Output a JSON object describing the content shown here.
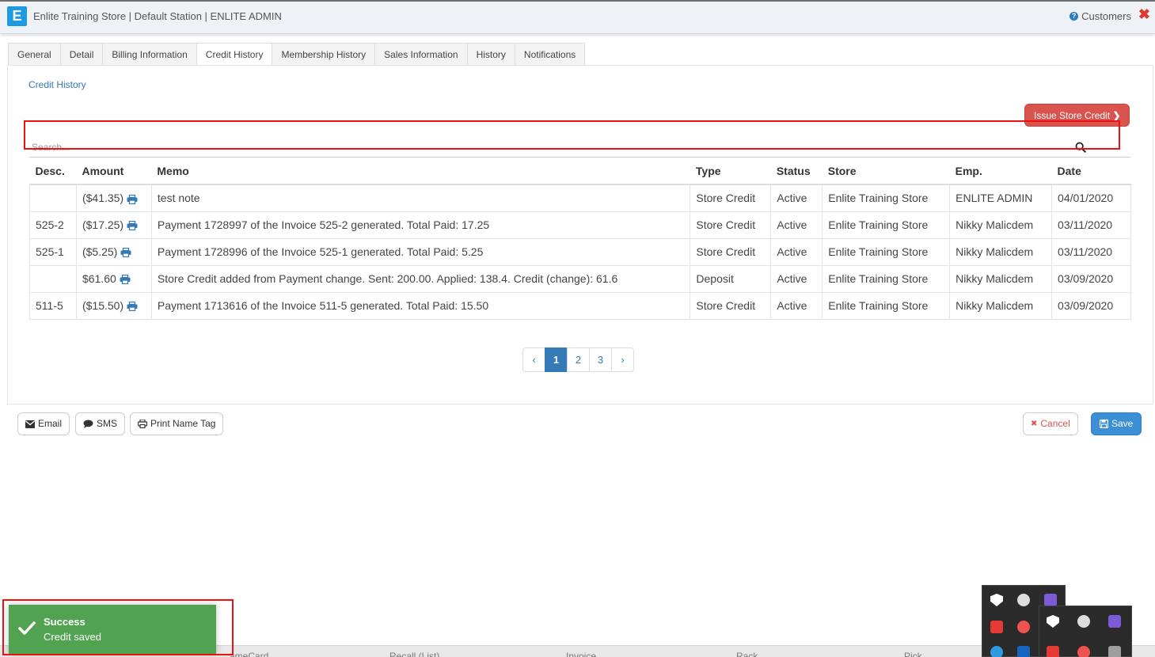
{
  "header": {
    "logo_letter": "E",
    "title": "Enlite Training Store | Default Station | ENLITE ADMIN",
    "help_icon": "question-circle-icon",
    "customers_label": "Customers",
    "close_icon": "close-x-icon",
    "close_glyph": "✖"
  },
  "tabs": [
    {
      "label": "General"
    },
    {
      "label": "Detail"
    },
    {
      "label": "Billing Information"
    },
    {
      "label": "Credit History",
      "active": true
    },
    {
      "label": "Membership History"
    },
    {
      "label": "Sales Information"
    },
    {
      "label": "History"
    },
    {
      "label": "Notifications"
    }
  ],
  "credit_history": {
    "section_link": "Credit History",
    "issue_button": "Issue Store Credit",
    "search_placeholder": "Search...",
    "columns": [
      "Desc.",
      "Amount",
      "Memo",
      "Type",
      "Status",
      "Store",
      "Emp.",
      "Date"
    ],
    "rows": [
      {
        "desc": "",
        "amount": "($41.35)",
        "memo": "test note",
        "type": "Store Credit",
        "status": "Active",
        "store": "Enlite Training Store",
        "emp": "ENLITE ADMIN",
        "date": "04/01/2020"
      },
      {
        "desc": "525-2",
        "amount": "($17.25)",
        "memo": "Payment 1728997 of the Invoice 525-2 generated. Total Paid: 17.25",
        "type": "Store Credit",
        "status": "Active",
        "store": "Enlite Training Store",
        "emp": "Nikky Malicdem",
        "date": "03/11/2020"
      },
      {
        "desc": "525-1",
        "amount": "($5.25)",
        "memo": "Payment 1728996 of the Invoice 525-1 generated. Total Paid: 5.25",
        "type": "Store Credit",
        "status": "Active",
        "store": "Enlite Training Store",
        "emp": "Nikky Malicdem",
        "date": "03/11/2020"
      },
      {
        "desc": "",
        "amount": "$61.60",
        "memo": "Store Credit added from Payment change. Sent: 200.00. Applied: 138.4. Credit (change): 61.6",
        "type": "Deposit",
        "status": "Active",
        "store": "Enlite Training Store",
        "emp": "Nikky Malicdem",
        "date": "03/09/2020"
      },
      {
        "desc": "511-5",
        "amount": "($15.50)",
        "memo": "Payment 1713616 of the Invoice 511-5 generated. Total Paid: 15.50",
        "type": "Store Credit",
        "status": "Active",
        "store": "Enlite Training Store",
        "emp": "Nikky Malicdem",
        "date": "03/09/2020"
      }
    ],
    "pagination": {
      "prev": "‹",
      "pages": [
        "1",
        "2",
        "3"
      ],
      "current": "1",
      "next": "›"
    }
  },
  "actions": {
    "email": "Email",
    "sms": "SMS",
    "print_name_tag": "Print Name Tag",
    "cancel": "Cancel",
    "cancel_glyph": "✖",
    "save": "Save"
  },
  "toast": {
    "title": "Success",
    "message": "Credit saved"
  },
  "footer_labels": [
    "ameCard",
    "Recall (List)",
    "Invoice",
    "Rack",
    "Pick"
  ],
  "colors": {
    "primary": "#337ab7",
    "danger": "#d9534f",
    "success": "#51a351",
    "highlight": "#ee1111"
  }
}
